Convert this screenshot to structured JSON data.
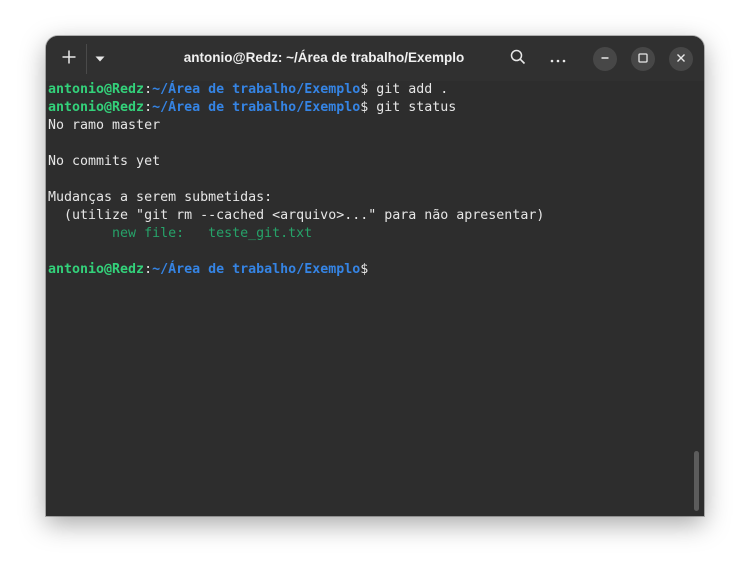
{
  "window": {
    "title": "antonio@Redz: ~/Área de trabalho/Exemplo"
  },
  "icons": {
    "new_tab": "plus-icon",
    "menu": "chevron-down-icon",
    "search": "search-icon",
    "more": "more-horizontal-icon",
    "minimize": "minimize-icon",
    "maximize": "maximize-icon",
    "close": "close-icon"
  },
  "colors": {
    "prompt_user": "#33d17a",
    "prompt_path": "#3584e4",
    "new_file": "#26a269",
    "background": "#2d2d2d"
  },
  "terminal": {
    "prompt_user": "antonio@Redz",
    "prompt_colon": ":",
    "prompt_path": "~/Área de trabalho/Exemplo",
    "prompt_sign": "$",
    "cmd1": " git add .",
    "cmd2": " git status",
    "out_branch": "No ramo master",
    "out_commits": "No commits yet",
    "out_changes": "Mudanças a serem submetidas:",
    "out_hint": "  (utilize \"git rm --cached <arquivo>...\" para não apresentar)",
    "out_newfile": "        new file:   teste_git.txt"
  }
}
